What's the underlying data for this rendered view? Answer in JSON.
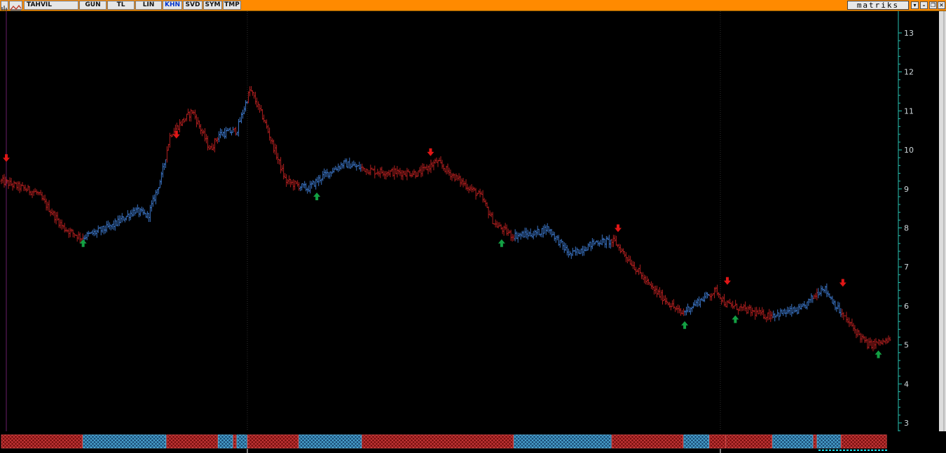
{
  "toolbar": {
    "tabs": [
      {
        "label": "TAHVIL",
        "active": false
      },
      {
        "label": "GUN",
        "active": false
      },
      {
        "label": "TL",
        "active": false
      },
      {
        "label": "LIN",
        "active": false
      },
      {
        "label": "KHN",
        "active": true
      },
      {
        "label": "SVD",
        "active": false
      },
      {
        "label": "SYM",
        "active": false
      },
      {
        "label": "TMP",
        "active": false
      }
    ],
    "brand": "matriks",
    "accent_color": "#ff8a00"
  },
  "chart_data": {
    "type": "bar",
    "style": "ohlc",
    "title": "",
    "xlabel": "",
    "ylabel": "",
    "ylim": [
      2.8,
      13.5
    ],
    "y_ticks": [
      "3",
      "4",
      "5",
      "6",
      "7",
      "8",
      "9",
      "10",
      "11",
      "12",
      "13"
    ],
    "y_axis_side": "right",
    "grid": "vertical dotted",
    "background": "#000000",
    "colors": {
      "up": "#3b74c4",
      "down": "#b01f1f",
      "buy_signal": "#13a043",
      "sell_signal": "#e01616",
      "axis": "#27c2b2"
    },
    "price_path": [
      [
        0,
        9.2
      ],
      [
        0.04,
        8.9
      ],
      [
        0.07,
        8.0
      ],
      [
        0.09,
        7.75
      ],
      [
        0.125,
        8.05
      ],
      [
        0.15,
        8.45
      ],
      [
        0.165,
        8.3
      ],
      [
        0.18,
        9.3
      ],
      [
        0.19,
        10.4
      ],
      [
        0.215,
        11.0
      ],
      [
        0.235,
        10.0
      ],
      [
        0.245,
        10.4
      ],
      [
        0.265,
        10.5
      ],
      [
        0.28,
        11.55
      ],
      [
        0.295,
        10.8
      ],
      [
        0.32,
        9.2
      ],
      [
        0.345,
        9.0
      ],
      [
        0.36,
        9.3
      ],
      [
        0.385,
        9.65
      ],
      [
        0.42,
        9.45
      ],
      [
        0.47,
        9.4
      ],
      [
        0.49,
        9.7
      ],
      [
        0.505,
        9.4
      ],
      [
        0.54,
        8.8
      ],
      [
        0.555,
        8.1
      ],
      [
        0.575,
        7.8
      ],
      [
        0.6,
        7.85
      ],
      [
        0.615,
        8.0
      ],
      [
        0.64,
        7.3
      ],
      [
        0.67,
        7.65
      ],
      [
        0.69,
        7.65
      ],
      [
        0.73,
        6.5
      ],
      [
        0.765,
        5.8
      ],
      [
        0.79,
        6.2
      ],
      [
        0.805,
        6.4
      ],
      [
        0.815,
        6.05
      ],
      [
        0.86,
        5.75
      ],
      [
        0.9,
        5.9
      ],
      [
        0.925,
        6.5
      ],
      [
        0.945,
        5.8
      ],
      [
        0.975,
        5.0
      ],
      [
        1.0,
        5.1
      ]
    ],
    "signals": [
      {
        "x": 0.0,
        "y": 9.8,
        "dir": "sell"
      },
      {
        "x": 0.092,
        "y": 7.6,
        "dir": "buy"
      },
      {
        "x": 0.197,
        "y": 10.4,
        "dir": "sell"
      },
      {
        "x": 0.355,
        "y": 8.8,
        "dir": "buy"
      },
      {
        "x": 0.483,
        "y": 9.95,
        "dir": "sell"
      },
      {
        "x": 0.563,
        "y": 7.6,
        "dir": "buy"
      },
      {
        "x": 0.694,
        "y": 8.0,
        "dir": "sell"
      },
      {
        "x": 0.769,
        "y": 5.5,
        "dir": "buy"
      },
      {
        "x": 0.817,
        "y": 6.65,
        "dir": "sell"
      },
      {
        "x": 0.826,
        "y": 5.65,
        "dir": "buy"
      },
      {
        "x": 0.947,
        "y": 6.6,
        "dir": "sell"
      },
      {
        "x": 0.987,
        "y": 4.75,
        "dir": "buy"
      }
    ],
    "regimes": [
      {
        "from": 0.0,
        "to": 0.092,
        "trend": "down"
      },
      {
        "from": 0.092,
        "to": 0.186,
        "trend": "up"
      },
      {
        "from": 0.186,
        "to": 0.244,
        "trend": "down"
      },
      {
        "from": 0.244,
        "to": 0.261,
        "trend": "up"
      },
      {
        "from": 0.261,
        "to": 0.265,
        "trend": "down"
      },
      {
        "from": 0.265,
        "to": 0.277,
        "trend": "up"
      },
      {
        "from": 0.277,
        "to": 0.335,
        "trend": "down"
      },
      {
        "from": 0.335,
        "to": 0.406,
        "trend": "up"
      },
      {
        "from": 0.406,
        "to": 0.577,
        "trend": "down"
      },
      {
        "from": 0.577,
        "to": 0.687,
        "trend": "up"
      },
      {
        "from": 0.687,
        "to": 0.768,
        "trend": "down"
      },
      {
        "from": 0.768,
        "to": 0.797,
        "trend": "up"
      },
      {
        "from": 0.797,
        "to": 0.816,
        "trend": "down"
      },
      {
        "from": 0.816,
        "to": 0.868,
        "trend": "down"
      },
      {
        "from": 0.868,
        "to": 0.914,
        "trend": "up"
      },
      {
        "from": 0.914,
        "to": 0.918,
        "trend": "down"
      },
      {
        "from": 0.918,
        "to": 0.945,
        "trend": "up"
      },
      {
        "from": 0.945,
        "to": 0.997,
        "trend": "down"
      }
    ]
  }
}
